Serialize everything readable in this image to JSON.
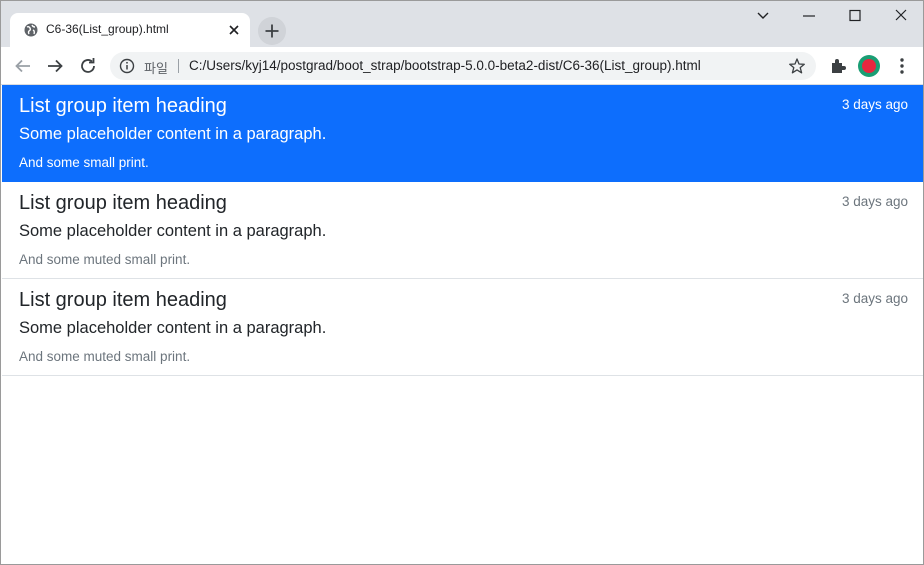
{
  "browser": {
    "tab_title": "C6-36(List_group).html",
    "omnibox_scheme_label": "파일",
    "url": "C:/Users/kyj14/postgrad/boot_strap/bootstrap-5.0.0-beta2-dist/C6-36(List_group).html"
  },
  "colors": {
    "active_item_bg": "#0d6efd",
    "muted_text": "#6c757d",
    "border": "#dee2e6"
  },
  "list_group": {
    "items": [
      {
        "heading": "List group item heading",
        "time": "3 days ago",
        "text": "Some placeholder content in a paragraph.",
        "small": "And some small print.",
        "active": true
      },
      {
        "heading": "List group item heading",
        "time": "3 days ago",
        "text": "Some placeholder content in a paragraph.",
        "small": "And some muted small print.",
        "active": false
      },
      {
        "heading": "List group item heading",
        "time": "3 days ago",
        "text": "Some placeholder content in a paragraph.",
        "small": "And some muted small print.",
        "active": false
      }
    ]
  }
}
